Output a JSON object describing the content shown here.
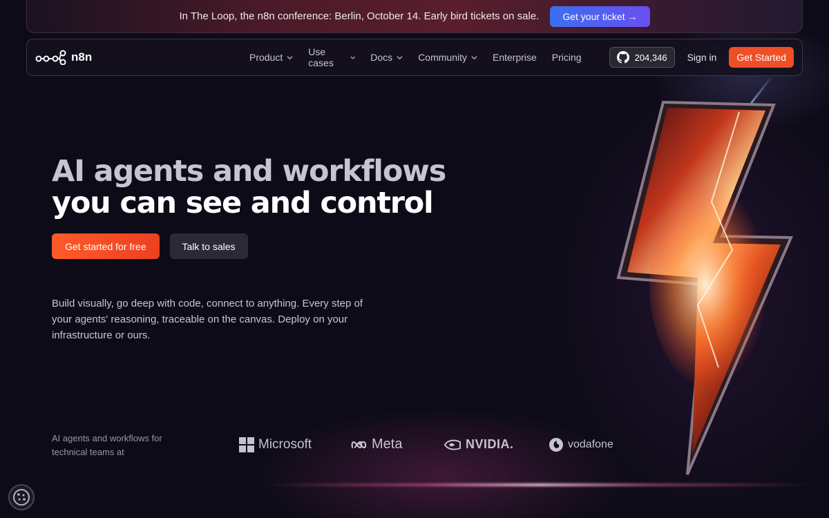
{
  "banner": {
    "text": "In The Loop, the n8n conference: Berlin, October 14. Early bird tickets on sale.",
    "button_label": "Get your ticket →"
  },
  "nav": {
    "logo_text": "n8n",
    "menu": [
      {
        "label": "Product",
        "dropdown": true
      },
      {
        "label": "Use cases",
        "dropdown": true
      },
      {
        "label": "Docs",
        "dropdown": true
      },
      {
        "label": "Community",
        "dropdown": true
      },
      {
        "label": "Enterprise",
        "dropdown": false
      },
      {
        "label": "Pricing",
        "dropdown": false
      }
    ],
    "github_stars": "204,346",
    "signin_label": "Sign in",
    "cta_label": "Get Started"
  },
  "hero": {
    "title_line1": "AI agents and workflows",
    "title_line2": "you can see and control",
    "primary_cta": "Get started for free",
    "secondary_cta": "Talk to sales",
    "description": "Build visually, go deep with code, connect to anything. Every step of your agents' reasoning, traceable on the canvas. Deploy on your infrastructure or ours."
  },
  "trust": {
    "label": "AI agents and workflows for technical teams at",
    "logos": [
      "Microsoft",
      "Meta",
      "NVIDIA.",
      "vodafone"
    ]
  },
  "colors": {
    "accent": "#ee4f27",
    "background": "#0e0b18",
    "ticket_button": "#3b6ff0"
  },
  "icons": {
    "logo": "n8n-nodes-icon",
    "github": "github-icon",
    "chevron": "chevron-down-icon",
    "cookie": "cookie-icon"
  }
}
